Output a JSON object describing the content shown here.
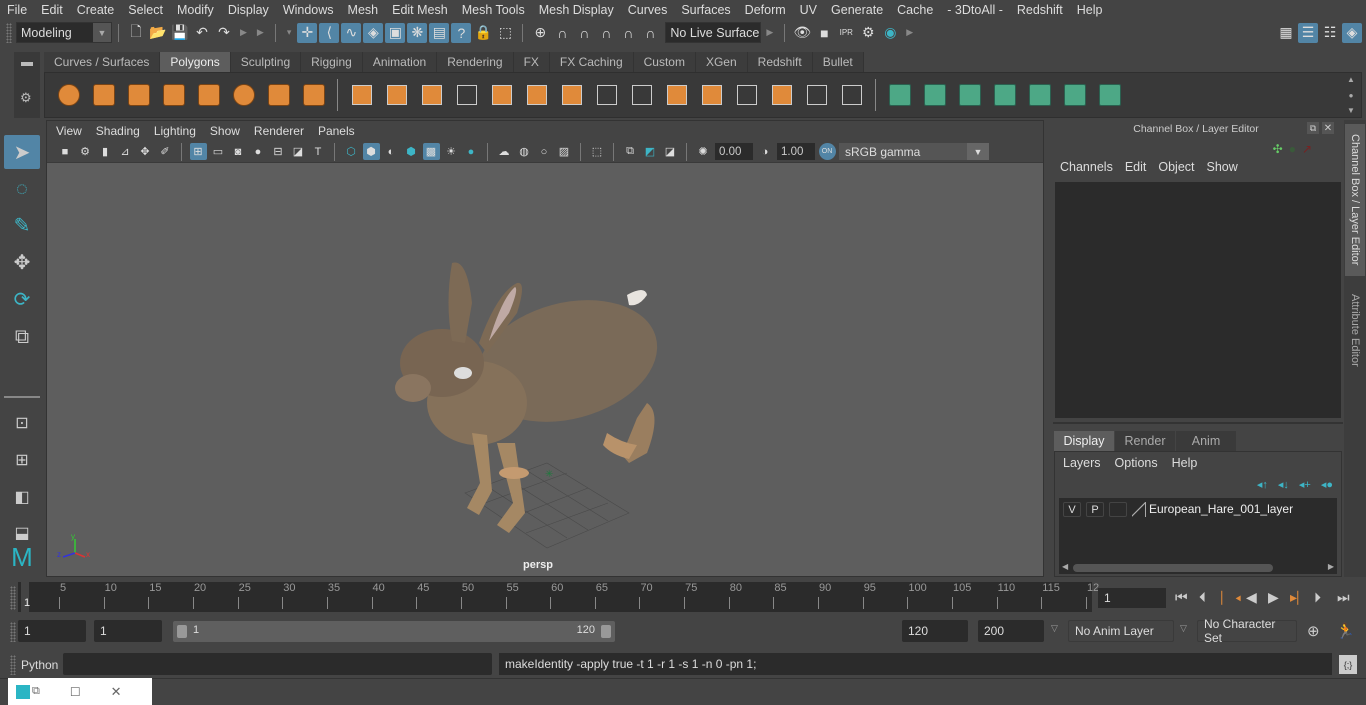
{
  "menubar": [
    "File",
    "Edit",
    "Create",
    "Select",
    "Modify",
    "Display",
    "Windows",
    "Mesh",
    "Edit Mesh",
    "Mesh Tools",
    "Mesh Display",
    "Curves",
    "Surfaces",
    "Deform",
    "UV",
    "Generate",
    "Cache",
    "- 3DtoAll -",
    "Redshift",
    "Help"
  ],
  "statusline": {
    "workspace": "Modeling",
    "live_surface": "No Live Surface"
  },
  "shelf": {
    "tabs": [
      "Curves / Surfaces",
      "Polygons",
      "Sculpting",
      "Rigging",
      "Animation",
      "Rendering",
      "FX",
      "FX Caching",
      "Custom",
      "XGen",
      "Redshift",
      "Bullet"
    ],
    "active_tab": "Polygons",
    "orange_icons": [
      "poly-sphere-icon",
      "poly-cube-icon",
      "poly-cylinder-icon",
      "poly-cone-icon",
      "poly-plane-icon",
      "poly-torus-icon",
      "poly-pyramid-icon",
      "poly-pipe-icon"
    ],
    "tool_icons": [
      "combine-icon",
      "separate-icon",
      "mirror-icon",
      "smooth-icon",
      "bevel-icon",
      "extrude-icon",
      "multi-cut-icon",
      "bridge-icon",
      "append-icon",
      "wedge-icon",
      "edge-loop-icon",
      "insert-loop-icon",
      "merge-icon",
      "target-weld-icon",
      "fill-hole-icon"
    ],
    "green_icons": [
      "planar-uv-icon",
      "cylindrical-uv-icon",
      "spherical-uv-icon",
      "automatic-uv-icon",
      "unfold-uv-icon",
      "uv-editor-icon",
      "layout-uv-icon"
    ]
  },
  "viewport": {
    "menu": [
      "View",
      "Shading",
      "Lighting",
      "Show",
      "Renderer",
      "Panels"
    ],
    "exposure": "0.00",
    "gamma": "1.00",
    "color_toggle": "ON",
    "colorspace": "sRGB gamma",
    "camera_label": "persp",
    "axis": {
      "x": "x",
      "y": "y",
      "z": "z"
    }
  },
  "channel_box": {
    "title": "Channel Box / Layer Editor",
    "menu": [
      "Channels",
      "Edit",
      "Object",
      "Show"
    ]
  },
  "layer_editor": {
    "tabs": [
      "Display",
      "Render",
      "Anim"
    ],
    "active_tab": "Display",
    "menu": [
      "Layers",
      "Options",
      "Help"
    ],
    "layers": [
      {
        "v": "V",
        "p": "P",
        "name": "European_Hare_001_layer"
      }
    ]
  },
  "side_tabs": [
    "Channel Box / Layer Editor",
    "Attribute Editor"
  ],
  "timeline": {
    "ticks": [
      "5",
      "10",
      "15",
      "20",
      "25",
      "30",
      "35",
      "40",
      "45",
      "50",
      "55",
      "60",
      "65",
      "70",
      "75",
      "80",
      "85",
      "90",
      "95",
      "100",
      "105",
      "110",
      "115",
      "12"
    ],
    "current_frame_marker": "1",
    "current_frame": "1"
  },
  "range": {
    "start": "1",
    "playback_start": "1",
    "slider_start": "1",
    "slider_end": "120",
    "playback_end": "120",
    "end": "200",
    "anim_layer": "No Anim Layer",
    "character_set": "No Character Set"
  },
  "command_line": {
    "language": "Python",
    "input": "",
    "result": "makeIdentity -apply true -t 1 -r 1 -s 1 -n 0 -pn 1;"
  },
  "colors": {
    "accent_blue": "#5285a6",
    "shelf_orange": "#e08a3a",
    "shelf_green": "#4da886",
    "panel_bg": "#444444",
    "field_bg": "#2b2b2b",
    "viewport_bg": "#5e5e5e"
  }
}
